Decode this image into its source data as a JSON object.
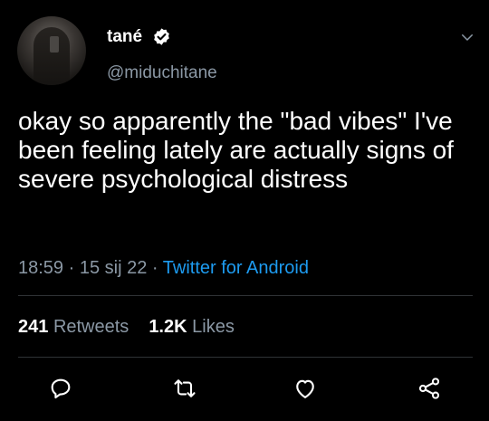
{
  "user": {
    "display_name": "tané",
    "handle": "@miduchitane",
    "verified": true
  },
  "tweet": {
    "text": "okay so apparently the \"bad vibes\" I've been feeling lately are actually signs of severe psychological distress",
    "time": "18:59",
    "separator": " · ",
    "date": "15 sij 22",
    "source": "Twitter for Android"
  },
  "stats": {
    "retweets_count": "241",
    "retweets_label": "Retweets",
    "likes_count": "1.2K",
    "likes_label": "Likes"
  },
  "actions": [
    "reply-icon",
    "retweet-icon",
    "like-icon",
    "share-icon"
  ],
  "colors": {
    "background": "#000000",
    "text": "#ffffff",
    "secondary": "#8b98a5",
    "link": "#1d9bf0",
    "divider": "#2f3336"
  }
}
